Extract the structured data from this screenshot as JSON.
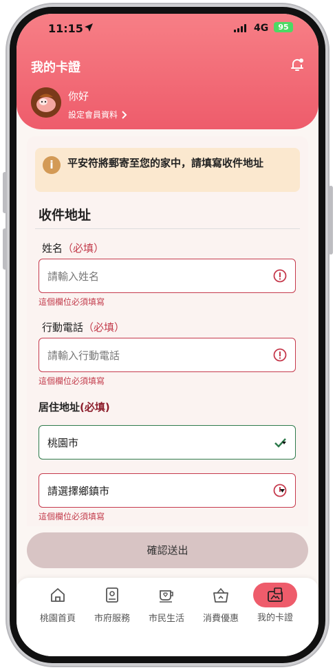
{
  "status_bar": {
    "time": "11:15",
    "network": "4G",
    "battery": "95"
  },
  "header": {
    "title": "我的卡證",
    "greeting": "你好",
    "profile_link": "設定會員資料"
  },
  "notice": {
    "icon": "info-icon",
    "text": "平安符將郵寄至您的家中，請填寫收件地址"
  },
  "form": {
    "section_title": "收件地址",
    "name": {
      "label": "姓名",
      "required": "（必填）",
      "placeholder": "請輸入姓名",
      "error": "這個欄位必須填寫"
    },
    "phone": {
      "label": "行動電話",
      "required": "（必填）",
      "placeholder": "請輸入行動電話",
      "error": "這個欄位必須填寫"
    },
    "address": {
      "label": "居住地址",
      "required": "(必填)",
      "city_value": "桃園市",
      "district_placeholder": "請選擇鄉鎮市",
      "error": "這個欄位必須填寫"
    }
  },
  "submit_label": "確認送出",
  "tabs": [
    {
      "label": "桃園首頁",
      "icon": "home-icon"
    },
    {
      "label": "市府服務",
      "icon": "city-service-icon"
    },
    {
      "label": "市民生活",
      "icon": "coffee-cup-icon"
    },
    {
      "label": "消費優惠",
      "icon": "shopping-bag-icon"
    },
    {
      "label": "我的卡證",
      "icon": "card-wallet-icon",
      "active": true
    }
  ],
  "colors": {
    "accent": "#ee5c6b",
    "error": "#c5384b",
    "valid": "#2d7a4b",
    "notice_bg": "#fbe8cf"
  }
}
